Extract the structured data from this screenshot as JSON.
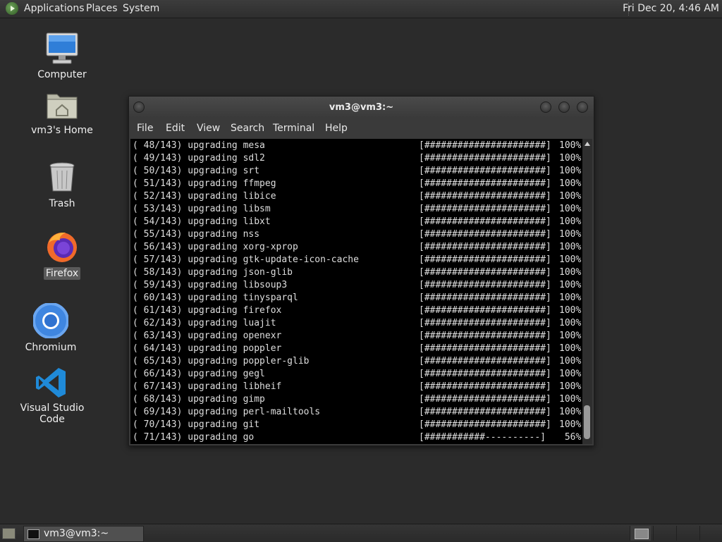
{
  "top_panel": {
    "menus": [
      "Applications",
      "Places",
      "System"
    ],
    "clock": "Fri Dec 20,  4:46 AM"
  },
  "desktop_icons": [
    {
      "label": "Computer",
      "icon": "computer-icon"
    },
    {
      "label": "vm3's Home",
      "icon": "home-folder-icon"
    },
    {
      "label": "Trash",
      "icon": "trash-icon"
    },
    {
      "label": "Firefox",
      "icon": "firefox-icon"
    },
    {
      "label": "Chromium",
      "icon": "chromium-icon"
    },
    {
      "label": "Visual Studio Code",
      "icon": "vscode-icon"
    }
  ],
  "terminal": {
    "title": "vm3@vm3:~",
    "menu": [
      "File",
      "Edit",
      "View",
      "Search",
      "Terminal",
      "Help"
    ],
    "lines": [
      {
        "index": "( 48/143)",
        "action": "upgrading",
        "package": "mesa",
        "bar": "[######################]",
        "percent": "100%"
      },
      {
        "index": "( 49/143)",
        "action": "upgrading",
        "package": "sdl2",
        "bar": "[######################]",
        "percent": "100%"
      },
      {
        "index": "( 50/143)",
        "action": "upgrading",
        "package": "srt",
        "bar": "[######################]",
        "percent": "100%"
      },
      {
        "index": "( 51/143)",
        "action": "upgrading",
        "package": "ffmpeg",
        "bar": "[######################]",
        "percent": "100%"
      },
      {
        "index": "( 52/143)",
        "action": "upgrading",
        "package": "libice",
        "bar": "[######################]",
        "percent": "100%"
      },
      {
        "index": "( 53/143)",
        "action": "upgrading",
        "package": "libsm",
        "bar": "[######################]",
        "percent": "100%"
      },
      {
        "index": "( 54/143)",
        "action": "upgrading",
        "package": "libxt",
        "bar": "[######################]",
        "percent": "100%"
      },
      {
        "index": "( 55/143)",
        "action": "upgrading",
        "package": "nss",
        "bar": "[######################]",
        "percent": "100%"
      },
      {
        "index": "( 56/143)",
        "action": "upgrading",
        "package": "xorg-xprop",
        "bar": "[######################]",
        "percent": "100%"
      },
      {
        "index": "( 57/143)",
        "action": "upgrading",
        "package": "gtk-update-icon-cache",
        "bar": "[######################]",
        "percent": "100%"
      },
      {
        "index": "( 58/143)",
        "action": "upgrading",
        "package": "json-glib",
        "bar": "[######################]",
        "percent": "100%"
      },
      {
        "index": "( 59/143)",
        "action": "upgrading",
        "package": "libsoup3",
        "bar": "[######################]",
        "percent": "100%"
      },
      {
        "index": "( 60/143)",
        "action": "upgrading",
        "package": "tinysparql",
        "bar": "[######################]",
        "percent": "100%"
      },
      {
        "index": "( 61/143)",
        "action": "upgrading",
        "package": "firefox",
        "bar": "[######################]",
        "percent": "100%"
      },
      {
        "index": "( 62/143)",
        "action": "upgrading",
        "package": "luajit",
        "bar": "[######################]",
        "percent": "100%"
      },
      {
        "index": "( 63/143)",
        "action": "upgrading",
        "package": "openexr",
        "bar": "[######################]",
        "percent": "100%"
      },
      {
        "index": "( 64/143)",
        "action": "upgrading",
        "package": "poppler",
        "bar": "[######################]",
        "percent": "100%"
      },
      {
        "index": "( 65/143)",
        "action": "upgrading",
        "package": "poppler-glib",
        "bar": "[######################]",
        "percent": "100%"
      },
      {
        "index": "( 66/143)",
        "action": "upgrading",
        "package": "gegl",
        "bar": "[######################]",
        "percent": "100%"
      },
      {
        "index": "( 67/143)",
        "action": "upgrading",
        "package": "libheif",
        "bar": "[######################]",
        "percent": "100%"
      },
      {
        "index": "( 68/143)",
        "action": "upgrading",
        "package": "gimp",
        "bar": "[######################]",
        "percent": "100%"
      },
      {
        "index": "( 69/143)",
        "action": "upgrading",
        "package": "perl-mailtools",
        "bar": "[######################]",
        "percent": "100%"
      },
      {
        "index": "( 70/143)",
        "action": "upgrading",
        "package": "git",
        "bar": "[######################]",
        "percent": "100%"
      },
      {
        "index": "( 71/143)",
        "action": "upgrading",
        "package": "go",
        "bar": "[###########----------]",
        "percent": " 56%"
      }
    ]
  },
  "taskbar": {
    "tasks": [
      {
        "label": "vm3@vm3:~"
      }
    ]
  },
  "colors": {
    "desktop": "#2b2b2b",
    "terminal_bg": "#000000",
    "terminal_fg": "#dedede"
  }
}
